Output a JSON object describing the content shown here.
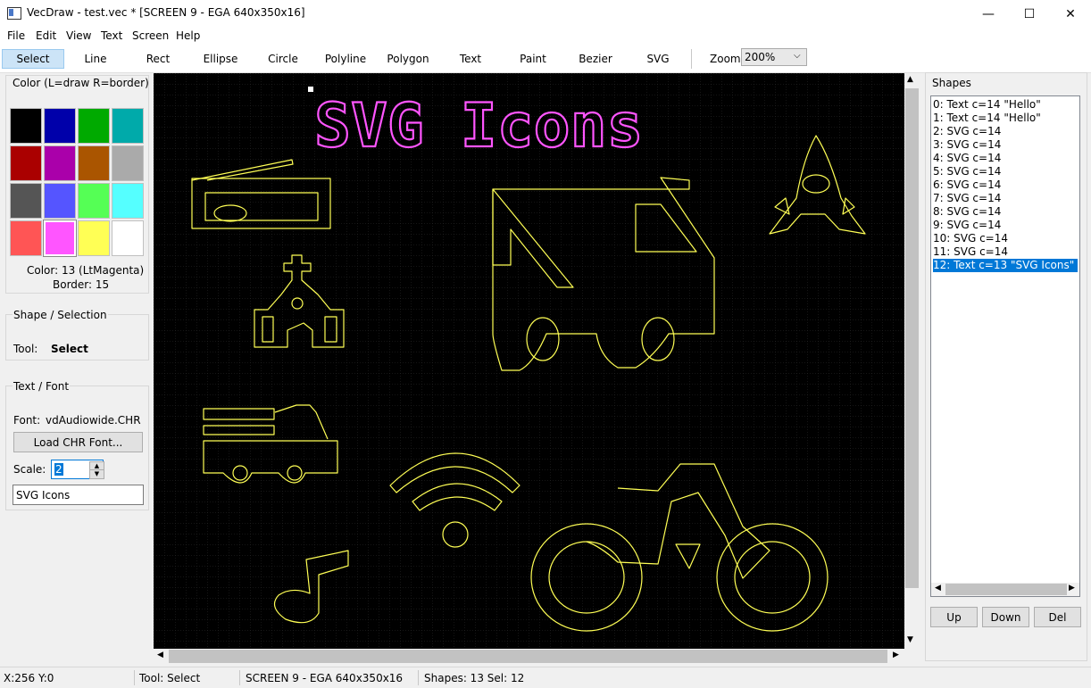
{
  "window": {
    "title": "VecDraw - test.vec * [SCREEN 9 - EGA 640x350x16]",
    "controls": {
      "minimize": "—",
      "maximize": "☐",
      "close": "✕"
    }
  },
  "menu": [
    "File",
    "Edit",
    "View",
    "Text",
    "Screen",
    "Help"
  ],
  "toolbar": {
    "tools": [
      "Select",
      "Line",
      "Rect",
      "Ellipse",
      "Circle",
      "Polyline",
      "Polygon",
      "Text",
      "Paint",
      "Bezier",
      "SVG"
    ],
    "active_tool": "Select",
    "zoom_label": "Zoom:",
    "zoom_value": "200%"
  },
  "color_panel": {
    "title": "Color (L=draw R=border)",
    "palette": [
      "#000000",
      "#0000aa",
      "#00aa00",
      "#00aaaa",
      "#aa0000",
      "#aa00aa",
      "#aa5500",
      "#aaaaaa",
      "#555555",
      "#5555ff",
      "#55ff55",
      "#55ffff",
      "#ff5555",
      "#ff55ff",
      "#ffff55",
      "#ffffff"
    ],
    "selected_index": 13,
    "color_text": "Color: 13 (LtMagenta)",
    "border_text": "Border: 15"
  },
  "selection_panel": {
    "title": "Shape / Selection",
    "tool_label": "Tool:",
    "tool_value": "Select"
  },
  "font_panel": {
    "title": "Text / Font",
    "font_label": "Font:",
    "font_value": "vdAudiowide.CHR",
    "load_button": "Load CHR Font...",
    "scale_label": "Scale:",
    "scale_value": "2",
    "text_value": "SVG Icons"
  },
  "canvas": {
    "title_text": "SVG Icons",
    "accent_text": "#ff55ff",
    "accent_icons": "#ffff55"
  },
  "shapes_panel": {
    "title": "Shapes",
    "items": [
      "0: Text  c=14 \"Hello\"",
      "1: Text  c=14 \"Hello\"",
      "2: SVG  c=14",
      "3: SVG  c=14",
      "4: SVG  c=14",
      "5: SVG  c=14",
      "6: SVG  c=14",
      "7: SVG  c=14",
      "8: SVG  c=14",
      "9: SVG  c=14",
      "10: SVG  c=14",
      "11: SVG  c=14",
      "12: Text  c=13 \"SVG Icons\""
    ],
    "selected_index": 12,
    "buttons": {
      "up": "Up",
      "down": "Down",
      "del": "Del"
    }
  },
  "statusbar": {
    "coords": "X:256 Y:0",
    "tool": "Tool: Select",
    "screen": "SCREEN 9 - EGA 640x350x16",
    "shapes": "Shapes: 13  Sel: 12"
  }
}
